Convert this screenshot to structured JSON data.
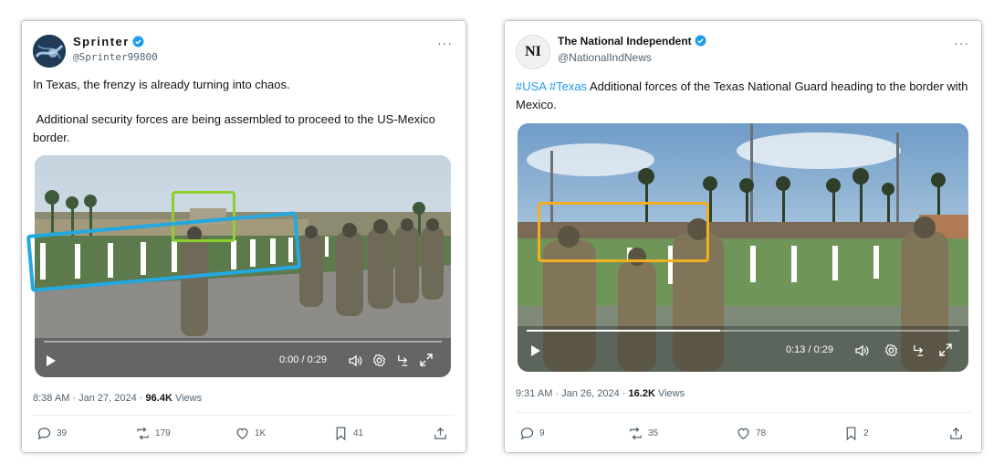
{
  "left": {
    "name": "Sprinter",
    "handle": "@Sprinter99800",
    "text_line1": "In Texas, the frenzy is already turning into chaos.",
    "text_line2": "Additional security forces are being assembled to proceed to the US-Mexico border.",
    "time": "0:00 / 0:29",
    "progress": 0.0,
    "date": "8:38 AM · Jan 27, 2024 · ",
    "views_count": "96.4K",
    "views_label": " Views",
    "replies": "39",
    "reposts": "179",
    "likes": "1K",
    "bookmarks": "41"
  },
  "right": {
    "name": "The National Independent",
    "handle": "@NationalIndNews",
    "avatar_text": "NI",
    "hashtags": "#USA #Texas",
    "text": " Additional forces of the Texas National Guard heading to the border with Mexico.",
    "time": "0:13 / 0:29",
    "progress": 0.448,
    "date": "9:31 AM · Jan 26, 2024 · ",
    "views_count": "16.2K",
    "views_label": " Views",
    "replies": "9",
    "reposts": "35",
    "likes": "78",
    "bookmarks": "2"
  },
  "colors": {
    "verified": "#1d9bf0",
    "highlight_blue": "#23a8e0",
    "highlight_green": "#8ccf2e",
    "highlight_orange": "#f0b020"
  },
  "icons": [
    "verified-icon",
    "more-icon",
    "play-icon",
    "volume-icon",
    "settings-icon",
    "repost-video-icon",
    "fullscreen-icon",
    "reply-icon",
    "repost-icon",
    "like-icon",
    "bookmark-icon",
    "share-icon"
  ]
}
